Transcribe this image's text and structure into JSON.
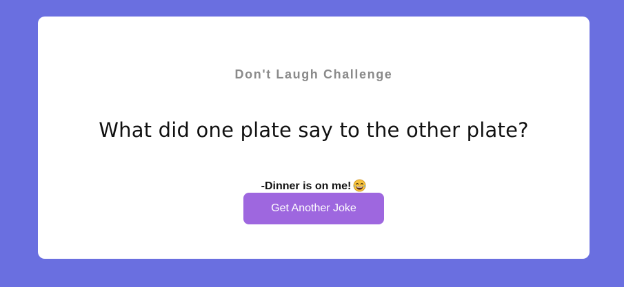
{
  "app": {
    "heading": "Don't Laugh Challenge"
  },
  "joke": {
    "setup": "What did one plate say to the other plate?",
    "punchline": "-Dinner is on me!",
    "emoji_icon": "laughing-tears-emoji"
  },
  "actions": {
    "next_joke_label": "Get Another Joke"
  },
  "colors": {
    "background": "#6a6fe0",
    "card": "#ffffff",
    "heading_text": "#8a8a8a",
    "button": "#9e67df",
    "button_text": "#ffffff"
  }
}
